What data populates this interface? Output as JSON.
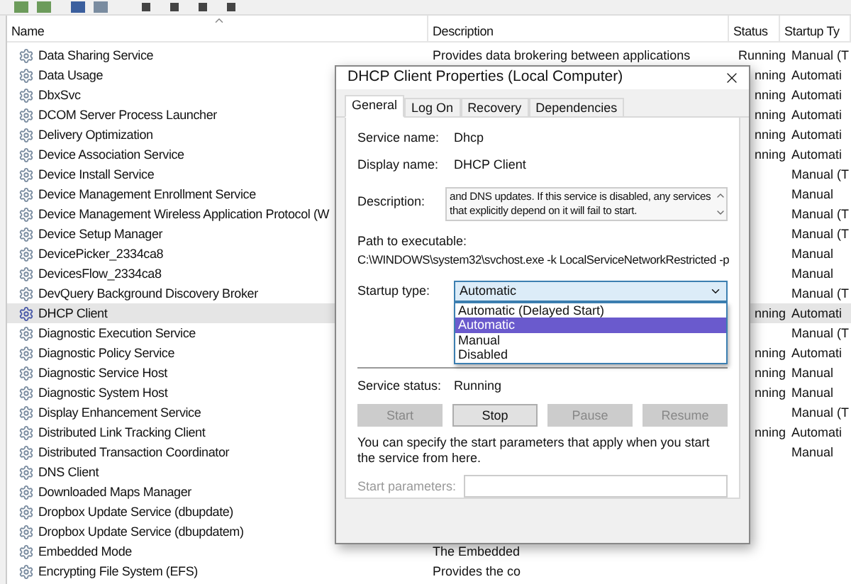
{
  "services": {
    "columns": [
      "Name",
      "Description",
      "Status",
      "Startup Ty"
    ],
    "rows": [
      {
        "name": "Data Sharing Service",
        "description": "Provides data brokering between applications",
        "status": "Running",
        "startup": "Manual (T",
        "selected": false
      },
      {
        "name": "Data Usage",
        "status": "nning",
        "startup": "Automati",
        "selected": false
      },
      {
        "name": "DbxSvc",
        "status": "nning",
        "startup": "Automati",
        "selected": false
      },
      {
        "name": "DCOM Server Process Launcher",
        "status": "nning",
        "startup": "Automati",
        "selected": false
      },
      {
        "name": "Delivery Optimization",
        "status": "nning",
        "startup": "Automati",
        "selected": false
      },
      {
        "name": "Device Association Service",
        "status": "nning",
        "startup": "Automati",
        "selected": false
      },
      {
        "name": "Device Install Service",
        "startup": "Manual (T",
        "selected": false
      },
      {
        "name": "Device Management Enrollment Service",
        "startup": "Manual",
        "selected": false
      },
      {
        "name": "Device Management Wireless Application Protocol (W",
        "startup": "Manual (T",
        "selected": false
      },
      {
        "name": "Device Setup Manager",
        "startup": "Manual (T",
        "selected": false
      },
      {
        "name": "DevicePicker_2334ca8",
        "startup": "Manual",
        "selected": false
      },
      {
        "name": "DevicesFlow_2334ca8",
        "startup": "Manual",
        "selected": false
      },
      {
        "name": "DevQuery Background Discovery Broker",
        "startup": "Manual (T",
        "selected": false
      },
      {
        "name": "DHCP Client",
        "status": "nning",
        "startup": "Automati",
        "selected": true
      },
      {
        "name": "Diagnostic Execution Service",
        "startup": "Manual (T",
        "selected": false
      },
      {
        "name": "Diagnostic Policy Service",
        "status": "nning",
        "startup": "Automati",
        "selected": false
      },
      {
        "name": "Diagnostic Service Host",
        "status": "nning",
        "startup": "Manual",
        "selected": false
      },
      {
        "name": "Diagnostic System Host",
        "status": "nning",
        "startup": "Manual",
        "selected": false
      },
      {
        "name": "Display Enhancement Service",
        "startup": "Manual (T",
        "selected": false
      },
      {
        "name": "Distributed Link Tracking Client",
        "status": "nning",
        "startup": "Automati",
        "selected": false
      },
      {
        "name": "Distributed Transaction Coordinator",
        "startup": "Manual",
        "selected": false
      },
      {
        "name": "DNS Client",
        "selected": false
      },
      {
        "name": "Downloaded Maps Manager",
        "selected": false
      },
      {
        "name": "Dropbox Update Service (dbupdate)",
        "selected": false
      },
      {
        "name": "Dropbox Update Service (dbupdatem)",
        "selected": false
      },
      {
        "name": "Embedded Mode",
        "description": "The Embedded",
        "selected": false
      },
      {
        "name": "Encrypting File System (EFS)",
        "description": "Provides the co",
        "selected": false
      }
    ]
  },
  "dialog": {
    "title": "DHCP Client Properties (Local Computer)",
    "tabs": [
      {
        "label": "General",
        "selected": true
      },
      {
        "label": "Log On",
        "selected": false
      },
      {
        "label": "Recovery",
        "selected": false
      },
      {
        "label": "Dependencies",
        "selected": false
      }
    ],
    "service_name": {
      "label": "Service name:",
      "value": "Dhcp"
    },
    "display_name": {
      "label": "Display name:",
      "value": "DHCP Client"
    },
    "description": {
      "label": "Description:",
      "value": "and DNS updates. If this service is disabled, any services that explicitly depend on it will fail to start."
    },
    "path": {
      "label": "Path to executable:",
      "value": "C:\\WINDOWS\\system32\\svchost.exe -k LocalServiceNetworkRestricted -p"
    },
    "startup_type": {
      "label": "Startup type:",
      "value": "Automatic",
      "expanded": true,
      "options": [
        {
          "label": "Automatic (Delayed Start)",
          "selected": false
        },
        {
          "label": "Automatic",
          "selected": true
        },
        {
          "label": "Manual",
          "selected": false
        },
        {
          "label": "Disabled",
          "selected": false
        }
      ]
    },
    "service_status": {
      "label": "Service status:",
      "value": "Running"
    },
    "buttons": [
      {
        "label": "Start",
        "disabled": true
      },
      {
        "label": "Stop",
        "disabled": false
      },
      {
        "label": "Pause",
        "disabled": true
      },
      {
        "label": "Resume",
        "disabled": true
      }
    ],
    "hint": "You can specify the start parameters that apply when you start the service from here.",
    "start_parameters": {
      "label": "Start parameters:",
      "disabled": true
    }
  }
}
